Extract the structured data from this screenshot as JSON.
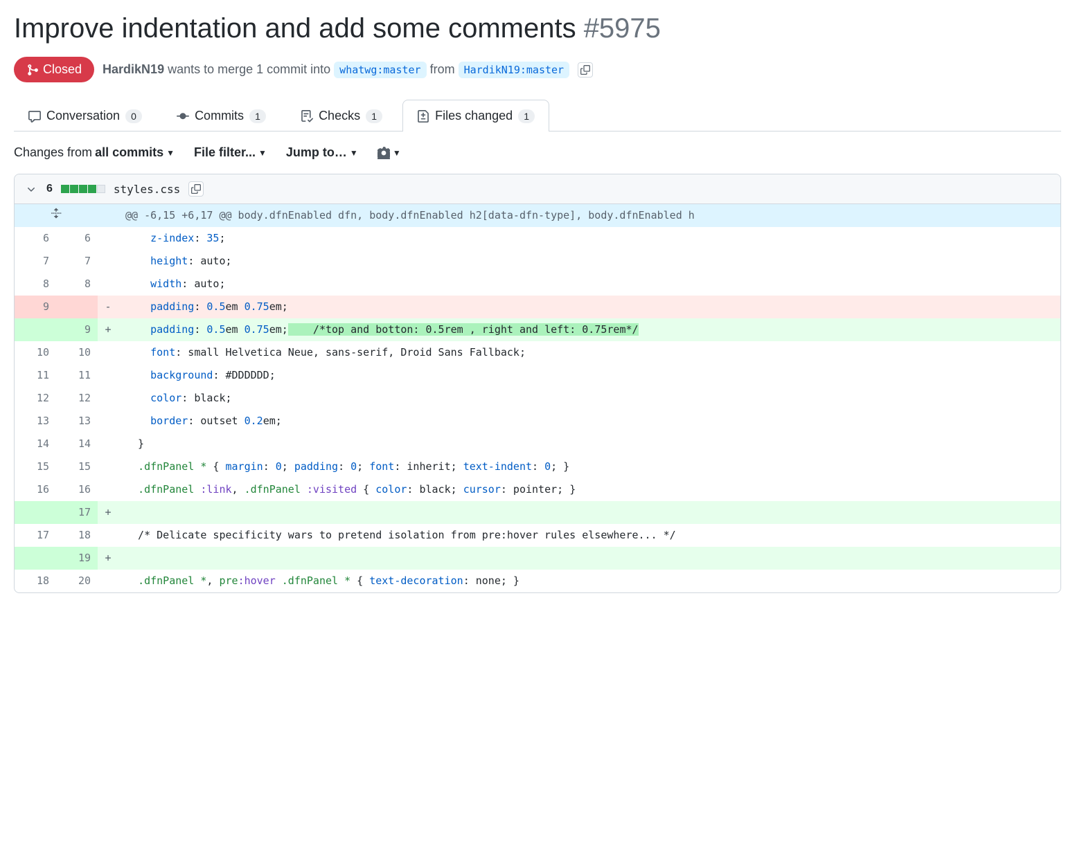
{
  "title": "Improve indentation and add some comments",
  "issue_number": "#5975",
  "state": "Closed",
  "meta": {
    "author": "HardikN19",
    "text1": " wants to merge 1 commit into ",
    "base": "whatwg:master",
    "text2": " from ",
    "head": "HardikN19:master"
  },
  "tabs": {
    "conversation": {
      "label": "Conversation",
      "count": "0"
    },
    "commits": {
      "label": "Commits",
      "count": "1"
    },
    "checks": {
      "label": "Checks",
      "count": "1"
    },
    "files": {
      "label": "Files changed",
      "count": "1"
    }
  },
  "toolbar": {
    "changes_prefix": "Changes from ",
    "changes_strong": "all commits",
    "file_filter": "File filter...",
    "jump_to": "Jump to…"
  },
  "file": {
    "diffstat": "6",
    "name": "styles.css",
    "blocks": {
      "add": 4,
      "neutral": 1
    }
  },
  "hunk_header": "@@ -6,15 +6,17 @@ body.dfnEnabled dfn, body.dfnEnabled h2[data-dfn-type], body.dfnEnabled h",
  "lines": [
    {
      "type": "context",
      "old": "6",
      "new": "6",
      "marker": " ",
      "tokens": [
        [
          "plain",
          "    "
        ],
        [
          "prop",
          "z-index"
        ],
        [
          "plain",
          ": "
        ],
        [
          "num",
          "35"
        ],
        [
          "plain",
          ";"
        ]
      ]
    },
    {
      "type": "context",
      "old": "7",
      "new": "7",
      "marker": " ",
      "tokens": [
        [
          "plain",
          "    "
        ],
        [
          "prop",
          "height"
        ],
        [
          "plain",
          ": auto;"
        ]
      ]
    },
    {
      "type": "context",
      "old": "8",
      "new": "8",
      "marker": " ",
      "tokens": [
        [
          "plain",
          "    "
        ],
        [
          "prop",
          "width"
        ],
        [
          "plain",
          ": auto;"
        ]
      ]
    },
    {
      "type": "deletion",
      "old": "9",
      "new": "",
      "marker": "-",
      "tokens": [
        [
          "plain",
          "    "
        ],
        [
          "prop",
          "padding"
        ],
        [
          "plain",
          ": "
        ],
        [
          "num",
          "0.5"
        ],
        [
          "plain",
          "em "
        ],
        [
          "num",
          "0.75"
        ],
        [
          "plain",
          "em;"
        ]
      ]
    },
    {
      "type": "addition",
      "old": "",
      "new": "9",
      "marker": "+",
      "tokens": [
        [
          "plain",
          "    "
        ],
        [
          "prop",
          "padding"
        ],
        [
          "plain",
          ": "
        ],
        [
          "num",
          "0.5"
        ],
        [
          "plain",
          "em "
        ],
        [
          "num",
          "0.75"
        ],
        [
          "plain",
          "em;"
        ],
        [
          "commenthi",
          "    /*top and botton: 0.5rem , right and left: 0.75rem*/"
        ]
      ]
    },
    {
      "type": "context",
      "old": "10",
      "new": "10",
      "marker": " ",
      "tokens": [
        [
          "plain",
          "    "
        ],
        [
          "prop",
          "font"
        ],
        [
          "plain",
          ": small Helvetica Neue, sans-serif, Droid Sans Fallback;"
        ]
      ]
    },
    {
      "type": "context",
      "old": "11",
      "new": "11",
      "marker": " ",
      "tokens": [
        [
          "plain",
          "    "
        ],
        [
          "prop",
          "background"
        ],
        [
          "plain",
          ": #DDDDDD;"
        ]
      ]
    },
    {
      "type": "context",
      "old": "12",
      "new": "12",
      "marker": " ",
      "tokens": [
        [
          "plain",
          "    "
        ],
        [
          "prop",
          "color"
        ],
        [
          "plain",
          ": black;"
        ]
      ]
    },
    {
      "type": "context",
      "old": "13",
      "new": "13",
      "marker": " ",
      "tokens": [
        [
          "plain",
          "    "
        ],
        [
          "prop",
          "border"
        ],
        [
          "plain",
          ": outset "
        ],
        [
          "num",
          "0.2"
        ],
        [
          "plain",
          "em;"
        ]
      ]
    },
    {
      "type": "context",
      "old": "14",
      "new": "14",
      "marker": " ",
      "tokens": [
        [
          "plain",
          "  }"
        ]
      ]
    },
    {
      "type": "context",
      "old": "15",
      "new": "15",
      "marker": " ",
      "tokens": [
        [
          "plain",
          "  "
        ],
        [
          "sel",
          ".dfnPanel"
        ],
        [
          "plain",
          " "
        ],
        [
          "sel",
          "*"
        ],
        [
          "plain",
          " { "
        ],
        [
          "prop",
          "margin"
        ],
        [
          "plain",
          ": "
        ],
        [
          "num",
          "0"
        ],
        [
          "plain",
          "; "
        ],
        [
          "prop",
          "padding"
        ],
        [
          "plain",
          ": "
        ],
        [
          "num",
          "0"
        ],
        [
          "plain",
          "; "
        ],
        [
          "prop",
          "font"
        ],
        [
          "plain",
          ": inherit; "
        ],
        [
          "prop",
          "text-indent"
        ],
        [
          "plain",
          ": "
        ],
        [
          "num",
          "0"
        ],
        [
          "plain",
          "; }"
        ]
      ]
    },
    {
      "type": "context",
      "old": "16",
      "new": "16",
      "marker": " ",
      "tokens": [
        [
          "plain",
          "  "
        ],
        [
          "sel",
          ".dfnPanel"
        ],
        [
          "plain",
          " "
        ],
        [
          "pseudo",
          ":link"
        ],
        [
          "plain",
          ", "
        ],
        [
          "sel",
          ".dfnPanel"
        ],
        [
          "plain",
          " "
        ],
        [
          "pseudo",
          ":visited"
        ],
        [
          "plain",
          " { "
        ],
        [
          "prop",
          "color"
        ],
        [
          "plain",
          ": black; "
        ],
        [
          "prop",
          "cursor"
        ],
        [
          "plain",
          ": pointer; }"
        ]
      ]
    },
    {
      "type": "addition",
      "old": "",
      "new": "17",
      "marker": "+",
      "tokens": []
    },
    {
      "type": "context",
      "old": "17",
      "new": "18",
      "marker": " ",
      "tokens": [
        [
          "plain",
          "  /* Delicate specificity wars to pretend isolation from pre:hover rules elsewhere... */"
        ]
      ]
    },
    {
      "type": "addition",
      "old": "",
      "new": "19",
      "marker": "+",
      "tokens": []
    },
    {
      "type": "context",
      "old": "18",
      "new": "20",
      "marker": " ",
      "tokens": [
        [
          "plain",
          "  "
        ],
        [
          "sel",
          ".dfnPanel"
        ],
        [
          "plain",
          " "
        ],
        [
          "sel",
          "*"
        ],
        [
          "plain",
          ", "
        ],
        [
          "sel",
          "pre"
        ],
        [
          "pseudo",
          ":hover"
        ],
        [
          "plain",
          " "
        ],
        [
          "sel",
          ".dfnPanel"
        ],
        [
          "plain",
          " "
        ],
        [
          "sel",
          "*"
        ],
        [
          "plain",
          " { "
        ],
        [
          "prop",
          "text-decoration"
        ],
        [
          "plain",
          ": none; }"
        ]
      ]
    }
  ]
}
